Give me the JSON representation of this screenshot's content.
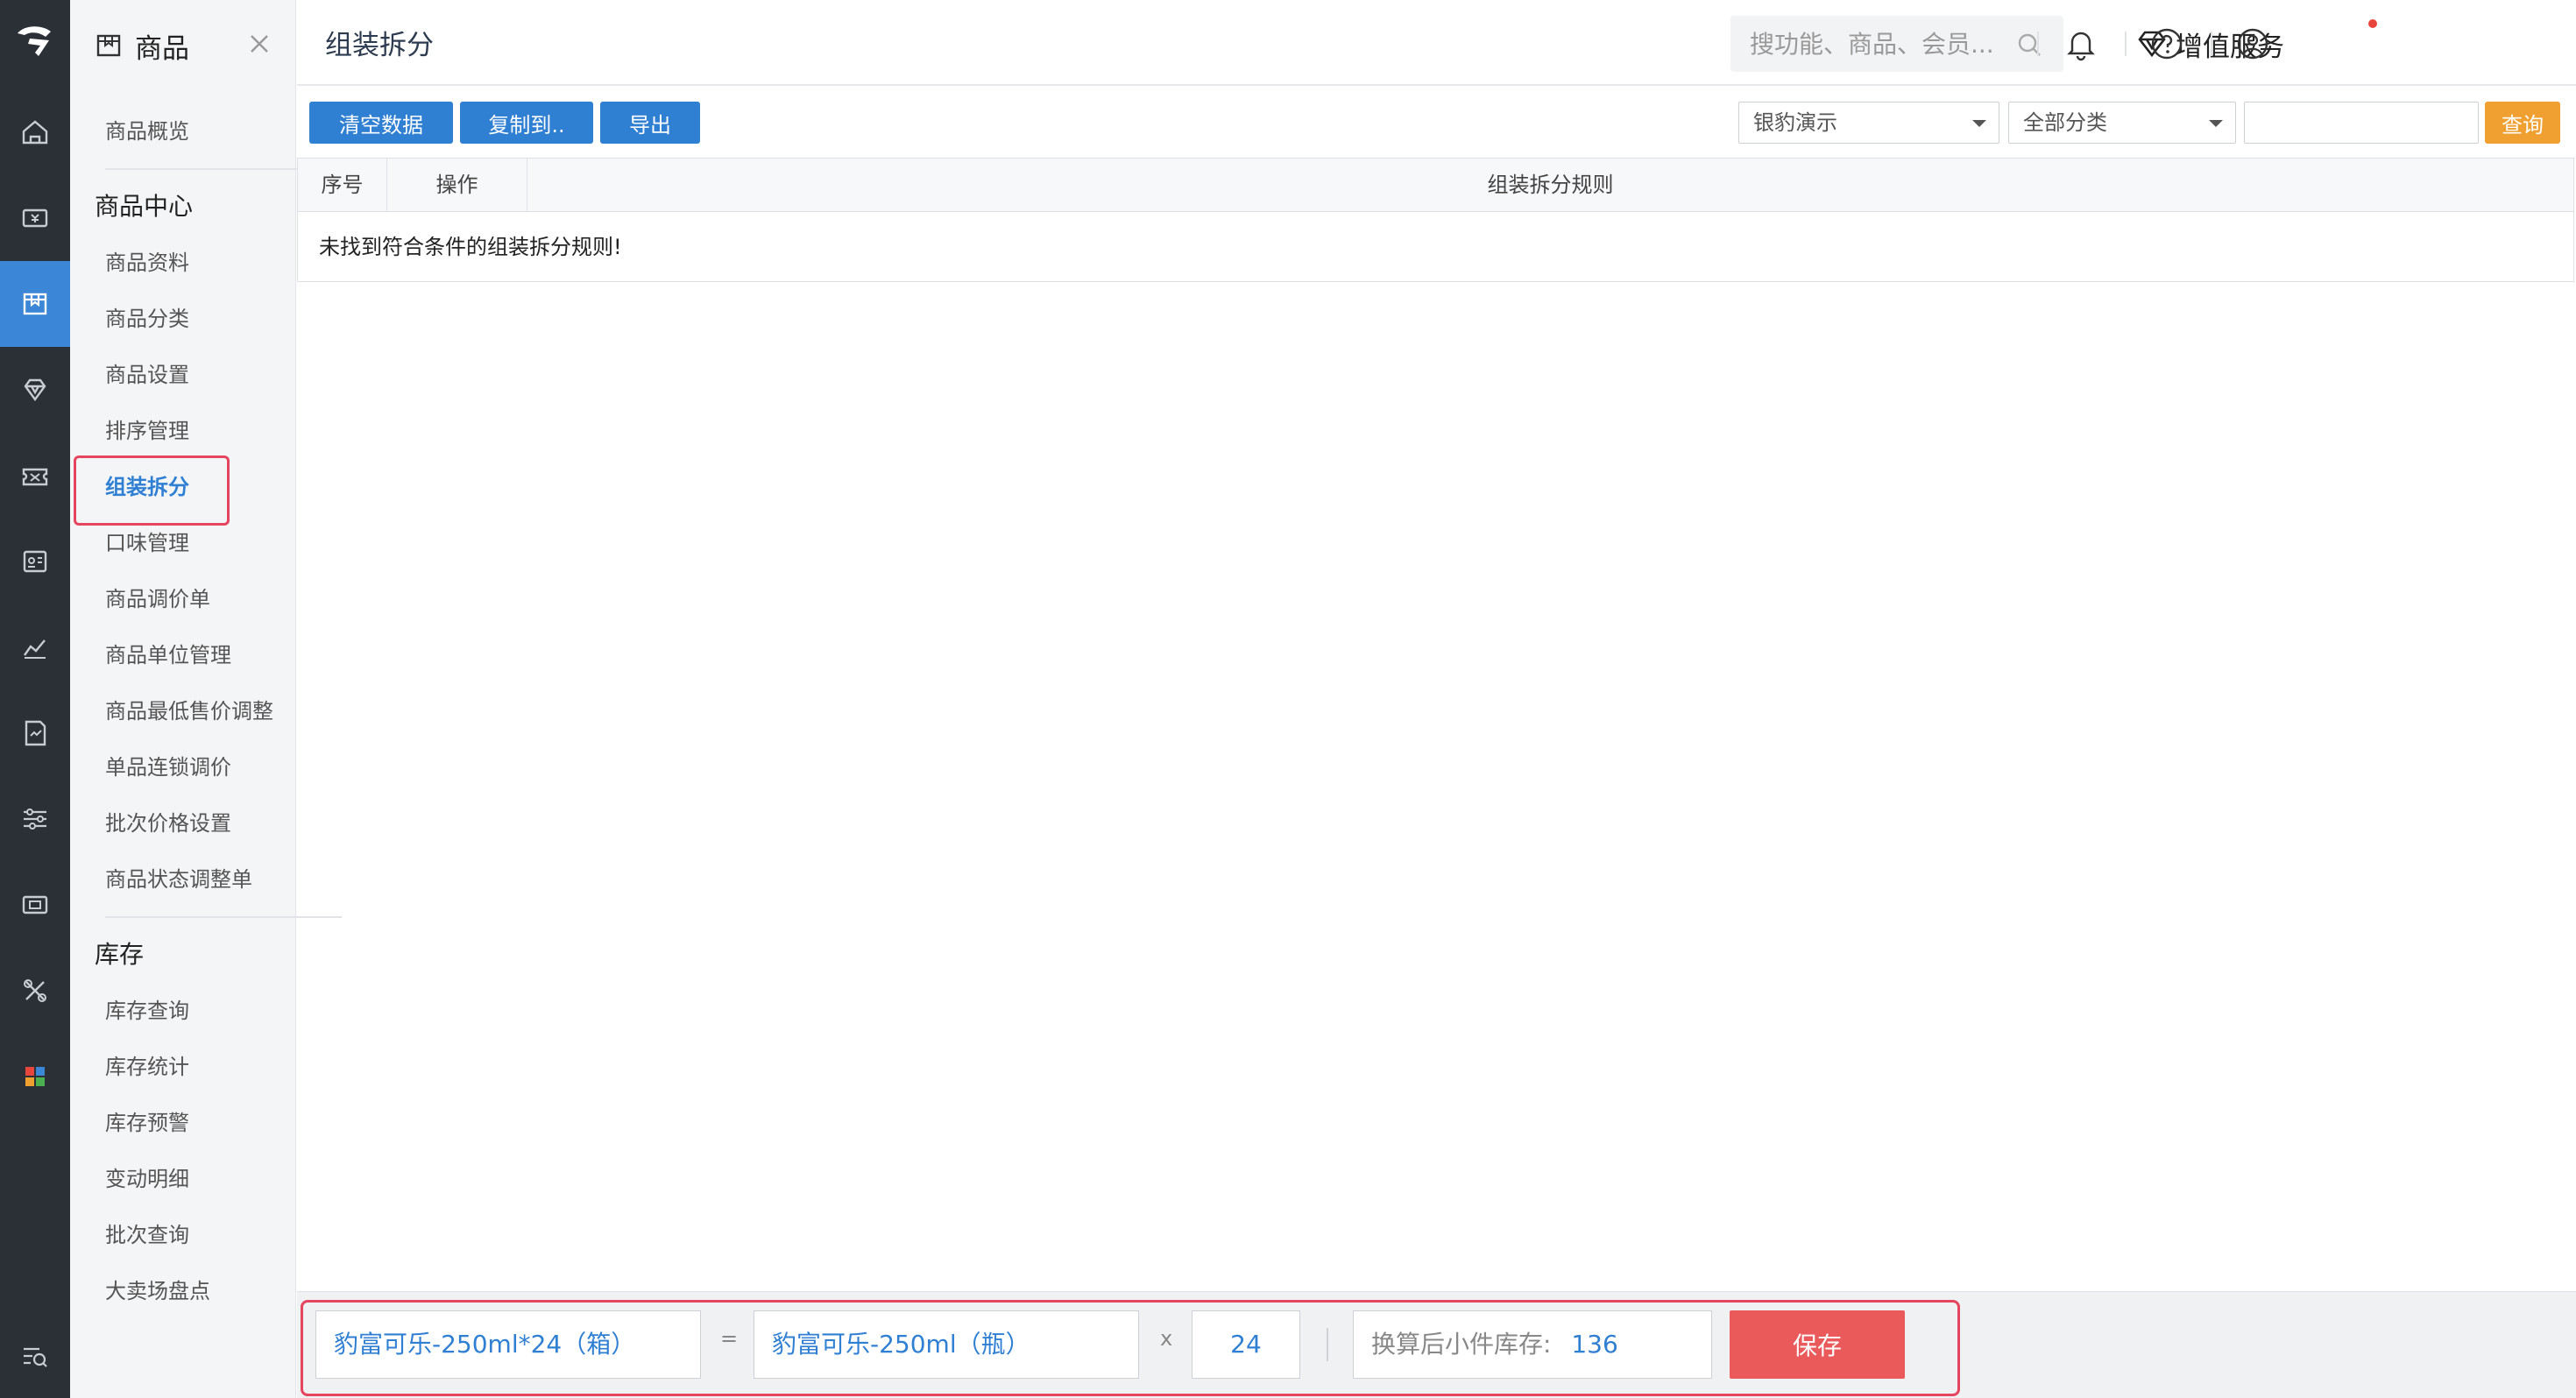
{
  "app": {
    "module_title": "商品",
    "page_title": "组装拆分"
  },
  "header": {
    "search_placeholder": "搜功能、商品、会员...",
    "value_added_label": "增值服务"
  },
  "sidebar": {
    "overview": "商品概览",
    "section1_title": "商品中心",
    "section1_items": [
      "商品资料",
      "商品分类",
      "商品设置",
      "排序管理",
      "组装拆分",
      "口味管理",
      "商品调价单",
      "商品单位管理",
      "商品最低售价调整",
      "单品连锁调价",
      "批次价格设置",
      "商品状态调整单"
    ],
    "section2_title": "库存",
    "section2_items": [
      "库存查询",
      "库存统计",
      "库存预警",
      "变动明细",
      "批次查询",
      "大卖场盘点"
    ]
  },
  "toolbar": {
    "clear_label": "清空数据",
    "copy_label": "复制到..",
    "export_label": "导出",
    "store_select": "银豹演示",
    "category_select": "全部分类",
    "query_label": "查询"
  },
  "table": {
    "columns": [
      "序号",
      "操作",
      "组装拆分规则"
    ],
    "empty_message": "未找到符合条件的组装拆分规则!"
  },
  "bottom": {
    "big_item": "豹富可乐-250ml*24（箱）",
    "equals": "=",
    "small_item": "豹富可乐-250ml（瓶）",
    "times": "x",
    "quantity": "24",
    "stock_label": "换算后小件库存:",
    "stock_value": "136",
    "save_label": "保存"
  },
  "colors": {
    "primary": "#2f7fd3",
    "query": "#f0a030",
    "save": "#ea5a5a",
    "highlight": "#e5455e",
    "rail": "#2b2f36"
  }
}
